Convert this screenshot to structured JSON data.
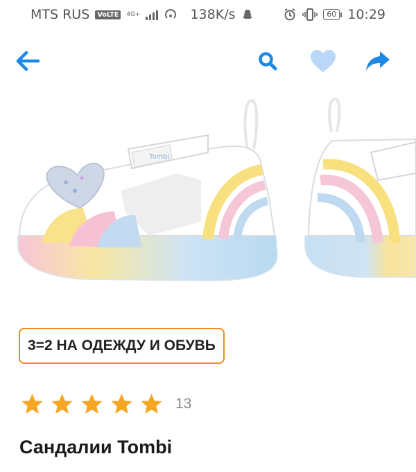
{
  "status_bar": {
    "carrier": "MTS RUS",
    "volte": "VoLTE",
    "network": "4G+",
    "speed": "138K/s",
    "battery": "60",
    "time": "10:29"
  },
  "toolbar": {
    "back_icon": "arrow-left-icon",
    "search_icon": "search-icon",
    "favorite_icon": "heart-icon",
    "share_icon": "share-arrow-icon",
    "accent_color": "#1e88e5",
    "favorite_color": "#b9d8f7"
  },
  "promo": {
    "label": "3=2 НА ОДЕЖДУ И ОБУВЬ",
    "border_color": "#ef8a1c"
  },
  "rating": {
    "stars": 5,
    "max_stars": 5,
    "count": "13",
    "star_color": "#f5a623"
  },
  "product": {
    "title": "Сандалии Tombi",
    "brand_on_shoe": "Tombi"
  }
}
